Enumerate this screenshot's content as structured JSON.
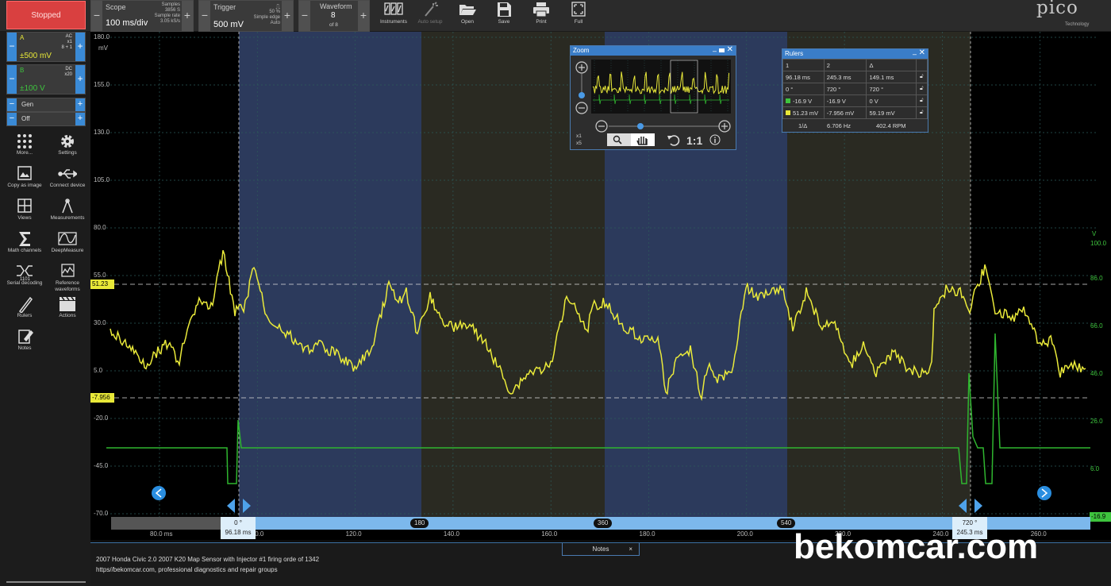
{
  "toolbar": {
    "run_status": "Stopped",
    "scope": {
      "title": "Scope",
      "timebase": "100 ms/div",
      "samples_label": "Samples",
      "samples_value": "3856 S",
      "rate_label": "Sample rate",
      "rate_value": "3.05 kS/s"
    },
    "trigger": {
      "title": "Trigger",
      "level": "500 mV",
      "percent": "50 %",
      "type": "Simple edge",
      "mode": "Auto"
    },
    "waveform": {
      "title": "Waveform",
      "current": "8",
      "of": "of 8"
    },
    "buttons": [
      {
        "label": "Instruments",
        "icon": "instruments-icon",
        "enabled": true
      },
      {
        "label": "Auto setup",
        "icon": "auto-setup-icon",
        "enabled": false
      },
      {
        "label": "Open",
        "icon": "folder-icon",
        "enabled": true
      },
      {
        "label": "Save",
        "icon": "save-icon",
        "enabled": true
      },
      {
        "label": "Print",
        "icon": "print-icon",
        "enabled": true
      },
      {
        "label": "Full",
        "icon": "fullscreen-icon",
        "enabled": true
      }
    ],
    "logo": {
      "brand": "pico",
      "sub": "Technology"
    }
  },
  "channels": [
    {
      "name": "A",
      "range": "±500 mV",
      "coupling": "AC",
      "probe": "x1",
      "extra": "8 + 1",
      "color": "#e8e838"
    },
    {
      "name": "B",
      "range": "±100 V",
      "coupling": "DC",
      "probe": "x20",
      "extra": "",
      "color": "#3ec43e"
    }
  ],
  "generator": {
    "label": "Gen",
    "state": "Off"
  },
  "tools": [
    {
      "label": "More...",
      "icon": "more-icon"
    },
    {
      "label": "Settings",
      "icon": "gear-icon"
    },
    {
      "label": "Copy as image",
      "icon": "copy-image-icon"
    },
    {
      "label": "Connect device",
      "icon": "usb-icon"
    },
    {
      "label": "Views",
      "icon": "views-icon"
    },
    {
      "label": "Measurements",
      "icon": "measurements-icon"
    },
    {
      "label": "Math channels",
      "icon": "sigma-icon"
    },
    {
      "label": "DeepMeasure",
      "icon": "deepmeasure-icon"
    },
    {
      "label": "Serial decoding",
      "icon": "serial-decoding-icon"
    },
    {
      "label": "Reference waveforms",
      "icon": "reference-waveforms-icon"
    },
    {
      "label": "Rulers",
      "icon": "ruler-icon"
    },
    {
      "label": "Actions",
      "icon": "actions-icon"
    },
    {
      "label": "Notes",
      "icon": "notes-icon"
    }
  ],
  "axes": {
    "left_unit": "mV",
    "left_ticks": [
      "180.0",
      "155.0",
      "130.0",
      "105.0",
      "80.0",
      "55.0",
      "30.0",
      "5.0",
      "-20.0",
      "-45.0",
      "-70.0"
    ],
    "right_unit": "V",
    "right_ticks": [
      "100.0",
      "86.0",
      "66.0",
      "46.0",
      "26.0",
      "6.0"
    ],
    "x_ticks": [
      "80.0 ms",
      "100.0",
      "120.0",
      "140.0",
      "160.0",
      "180.0",
      "200.0",
      "220.0",
      "240.0",
      "260.0"
    ],
    "ruler_a_value": "51.23",
    "ruler_b_value": "-7.956",
    "right_marker": "-16.9"
  },
  "rotation_ruler": {
    "angles": [
      "180",
      "360",
      "540"
    ],
    "tag1": {
      "angle": "0 °",
      "time": "96.18 ms"
    },
    "tag2": {
      "angle": "720 °",
      "time": "245.3 ms"
    }
  },
  "zoom": {
    "title": "Zoom",
    "x1": "x1",
    "x5": "x5",
    "ratio": "1:1"
  },
  "rulers": {
    "title": "Rulers",
    "header": [
      "1",
      "2",
      "Δ"
    ],
    "rows": [
      [
        "96.18 ms",
        "245.3 ms",
        "149.1 ms"
      ],
      [
        "0 °",
        "720 °",
        "720 °"
      ],
      [
        "-16.9 V",
        "-16.9 V",
        "0 V"
      ],
      [
        "51.23 mV",
        "-7.956 mV",
        "59.19 mV"
      ]
    ],
    "row_colors": [
      "",
      "",
      "#3ec43e",
      "#e8e838"
    ],
    "freq_label": "1/Δ",
    "freq_value": "6.706 Hz",
    "rpm_value": "402.4 RPM"
  },
  "notes": {
    "tab": "Notes",
    "line1": "2007 Honda Civic 2.0 2007 K20 Map Sensor with Injector  #1 firing orde of 1342",
    "line2": "https//bekomcar.com, professional diagnostics and repair groups"
  },
  "watermark": "bekomcar.com"
}
